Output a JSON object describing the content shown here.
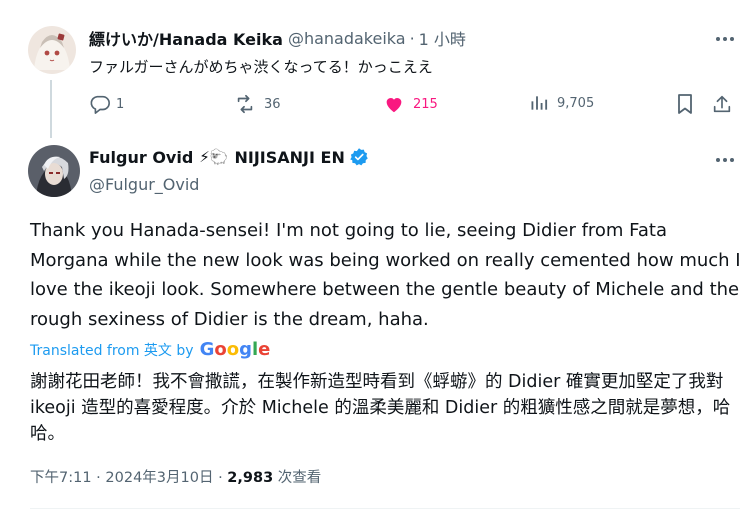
{
  "reply": {
    "display_name": "縹けいか/Hanada Keika",
    "handle": "@hanadakeika",
    "separator": "·",
    "time": "1 小時",
    "text": "ファルガーさんがめちゃ渋くなってる！かっこええ",
    "actions": {
      "replies": "1",
      "reposts": "36",
      "likes": "215",
      "views": "9,705"
    }
  },
  "main": {
    "display_name": "Fulgur Ovid",
    "name_emojis": "⚡🐑",
    "name_suffix": "NIJISANJI EN",
    "handle": "@Fulgur_Ovid",
    "text": "Thank you Hanada-sensei! I'm not going to lie, seeing Didier from Fata Morgana while the new look was being worked on really cemented how much I love the ikeoji look. Somewhere between the gentle beauty of Michele and the rough sexiness of Didier is the dream, haha.",
    "translated_label": "Translated from 英文 by",
    "translated_provider": "Google",
    "translated_text": "謝謝花田老師！我不會撒謊，在製作新造型時看到《蜉蝣》的 Didier 確實更加堅定了我對 ikeoji 造型的喜愛程度。介於 Michele 的溫柔美麗和 Didier 的粗獷性感之間就是夢想，哈哈。",
    "meta_time": "下午7:11 · 2024年3月10日 · ",
    "views_count": "2,983",
    "views_label": " 次查看"
  },
  "icons": {
    "more": "more-icon",
    "reply": "reply-icon",
    "repost": "repost-icon",
    "like": "heart-icon",
    "views": "views-icon",
    "bookmark": "bookmark-icon",
    "share": "share-icon",
    "verified": "verified-badge-icon"
  },
  "colors": {
    "like": "#f91880",
    "link": "#1d9bf0",
    "muted": "#536471",
    "verified": "#1d9bf0"
  }
}
